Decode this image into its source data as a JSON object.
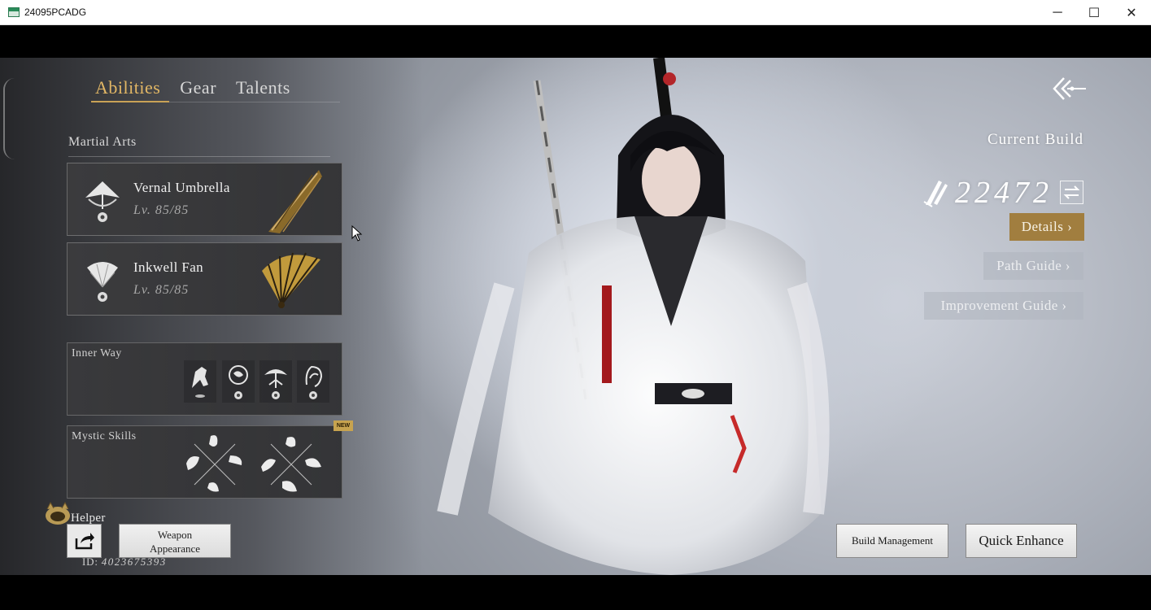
{
  "window": {
    "title": "24095PCADG",
    "controls": {
      "minimize": "─",
      "maximize": "☐",
      "close": "✕"
    }
  },
  "tabs": [
    {
      "label": "Abilities",
      "active": true
    },
    {
      "label": "Gear",
      "active": false
    },
    {
      "label": "Talents",
      "active": false
    }
  ],
  "martial_arts": {
    "title": "Martial Arts",
    "weapons": [
      {
        "name": "Vernal Umbrella",
        "level": "Lv. 85/85",
        "icon": "umbrella-icon"
      },
      {
        "name": "Inkwell Fan",
        "level": "Lv. 85/85",
        "icon": "fan-icon"
      }
    ]
  },
  "inner_way": {
    "title": "Inner Way",
    "slots": [
      "horse-icon",
      "orb-icon",
      "tree-icon",
      "hand-icon"
    ]
  },
  "mystic_skills": {
    "title": "Mystic Skills",
    "badge": "NEW"
  },
  "helper": {
    "label": "Helper"
  },
  "buttons": {
    "weapon_appearance_line1": "Weapon",
    "weapon_appearance_line2": "Appearance",
    "build_management": "Build Management",
    "quick_enhance": "Quick Enhance",
    "details": "Details ›",
    "path_guide": "Path Guide ›",
    "improvement_guide": "Improvement Guide ›"
  },
  "player": {
    "id_label": "ID:",
    "id_value": "4023675393"
  },
  "build": {
    "title": "Current Build",
    "power": "22472"
  },
  "colors": {
    "accent_gold": "#e2b765",
    "details_button": "#a17e3f"
  }
}
